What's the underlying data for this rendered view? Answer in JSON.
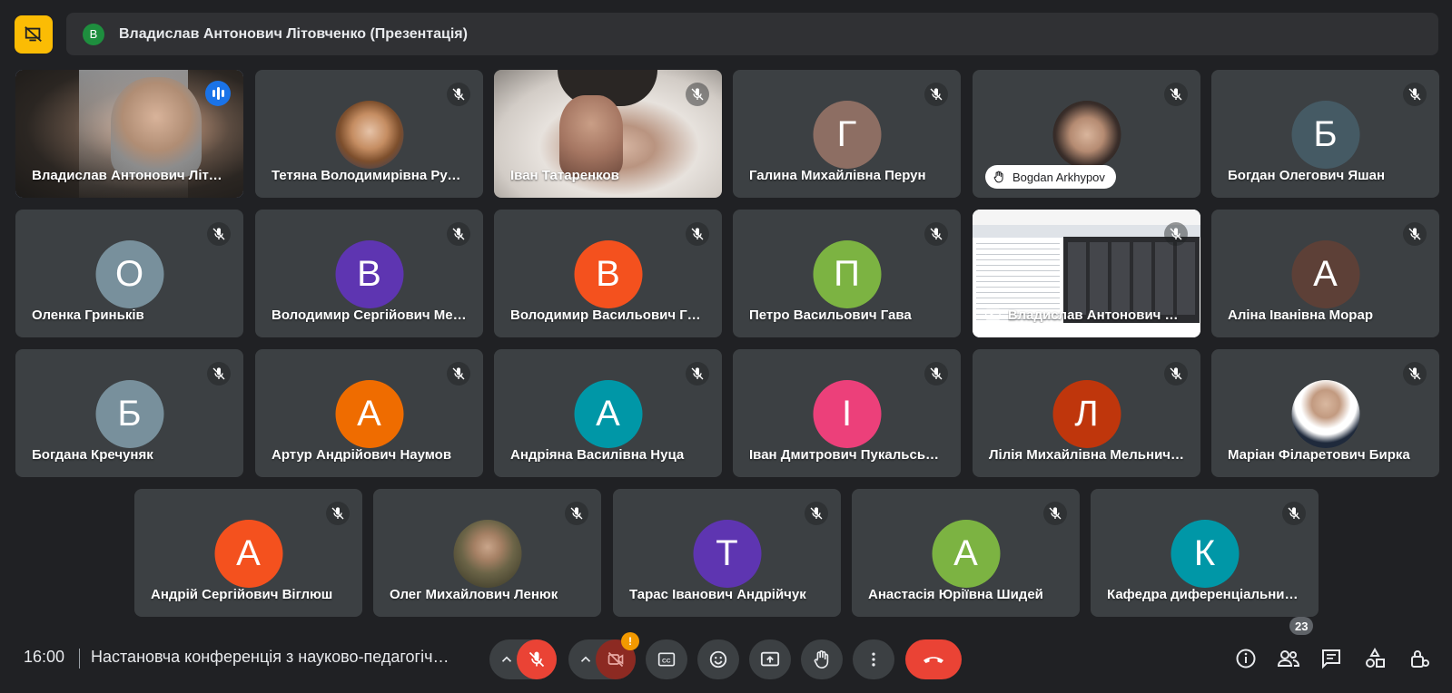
{
  "presentation": {
    "avatar_letter": "В",
    "banner_text": "Владислав Антонович Літовченко (Презентація)"
  },
  "tiles": [
    {
      "name": "Владислав Антонович Літовченко"
    },
    {
      "name": "Тетяна Володимирівна Руденко"
    },
    {
      "name": "Іван Татаренков"
    },
    {
      "name": "Галина Михайлівна Перун",
      "letter": "Г"
    },
    {
      "name": "Bogdan Arkhypov"
    },
    {
      "name": "Богдан Олегович Яшан",
      "letter": "Б"
    },
    {
      "name": "Оленка Гриньків",
      "letter": "О"
    },
    {
      "name": "Володимир Сергійович Мельник",
      "letter": "В"
    },
    {
      "name": "Володимир Васильович Гайович",
      "letter": "В"
    },
    {
      "name": "Петро Васильович Гава",
      "letter": "П"
    },
    {
      "name": "Владислав Антонович Літовченко"
    },
    {
      "name": "Аліна Іванівна Морар",
      "letter": "А"
    },
    {
      "name": "Богдана Кречуняк",
      "letter": "Б"
    },
    {
      "name": "Артур Андрійович Наумов",
      "letter": "А"
    },
    {
      "name": "Андріяна Василівна Нуца",
      "letter": "А"
    },
    {
      "name": "Іван Дмитрович Пукальський",
      "letter": "І"
    },
    {
      "name": "Лілія Михайлівна Мельничук",
      "letter": "Л"
    },
    {
      "name": "Маріан Філаретович Бирка"
    },
    {
      "name": "Андрій Сергійович Віглюш",
      "letter": "А"
    },
    {
      "name": "Олег Михайлович Ленюк"
    },
    {
      "name": "Тарас Іванович Андрійчук",
      "letter": "Т"
    },
    {
      "name": "Анастасія Юріївна Шидей",
      "letter": "А"
    },
    {
      "name": "Кафедра диференціальних рівнянь",
      "letter": "К"
    }
  ],
  "bottombar": {
    "time": "16:00",
    "meeting_title": "Настановча конференція з науково-педагогічної практики",
    "camera_warning": "!",
    "people_count": "23"
  },
  "colors": {
    "background": "#202124",
    "tile": "#3c4043",
    "accent": "#8ab4f8",
    "end_call": "#ea4335",
    "present_button": "#fbbc04"
  },
  "icons": {
    "present": "stop-presenting-icon",
    "mic_off": "mic-off-icon",
    "speaking": "audio-level-icon",
    "hand": "raised-hand-icon",
    "presenting": "present-screen-icon",
    "captions": "captions-icon",
    "emoji": "emoji-icon",
    "present_now": "present-now-icon",
    "raise_hand": "raise-hand-icon",
    "more": "more-vert-icon",
    "end_call": "end-call-icon",
    "info": "info-icon",
    "people": "people-icon",
    "chat": "chat-icon",
    "activities": "activities-icon",
    "host_controls": "host-controls-icon"
  }
}
